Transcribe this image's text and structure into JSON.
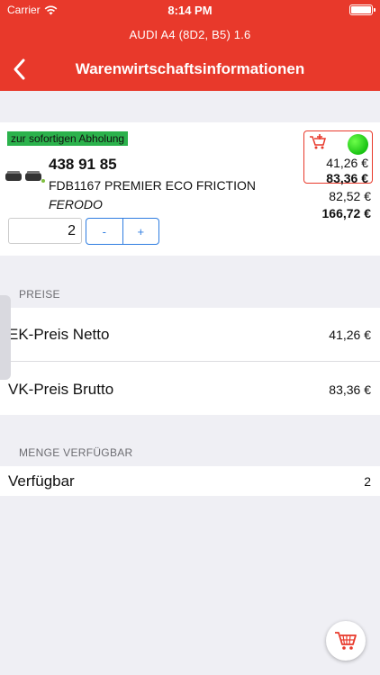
{
  "status": {
    "carrier": "Carrier",
    "time": "8:14 PM"
  },
  "header": {
    "subtitle": "AUDI A4 (8D2, B5) 1.6",
    "title": "Warenwirtschaftsinformationen"
  },
  "article": {
    "badge": "zur sofortigen Abholung",
    "number": "438 91 85",
    "description": "FDB1167 PREMIER ECO FRICTION",
    "brand": "FERODO",
    "quantity": "2",
    "minus": "-",
    "plus": "+",
    "price_net": "41,26 €",
    "price_gross": "83,36 €",
    "price_net_total": "82,52 €",
    "price_gross_total": "166,72 €",
    "availability_color": "#19c313"
  },
  "prices_section": {
    "header": "PREISE",
    "rows": [
      {
        "label": "EK-Preis Netto",
        "value": "41,26 €"
      },
      {
        "label": "VK-Preis Brutto",
        "value": "83,36 €"
      }
    ]
  },
  "stock_section": {
    "header": "MENGE VERFÜGBAR",
    "rows": [
      {
        "label": "Verfügbar",
        "value": "2"
      }
    ]
  },
  "accent_color": "#e8392b",
  "icons": [
    "wifi-icon",
    "battery-icon",
    "back-chevron-icon",
    "cart-add-icon",
    "availability-dot-icon",
    "brake-pad-icon",
    "cart-icon"
  ]
}
